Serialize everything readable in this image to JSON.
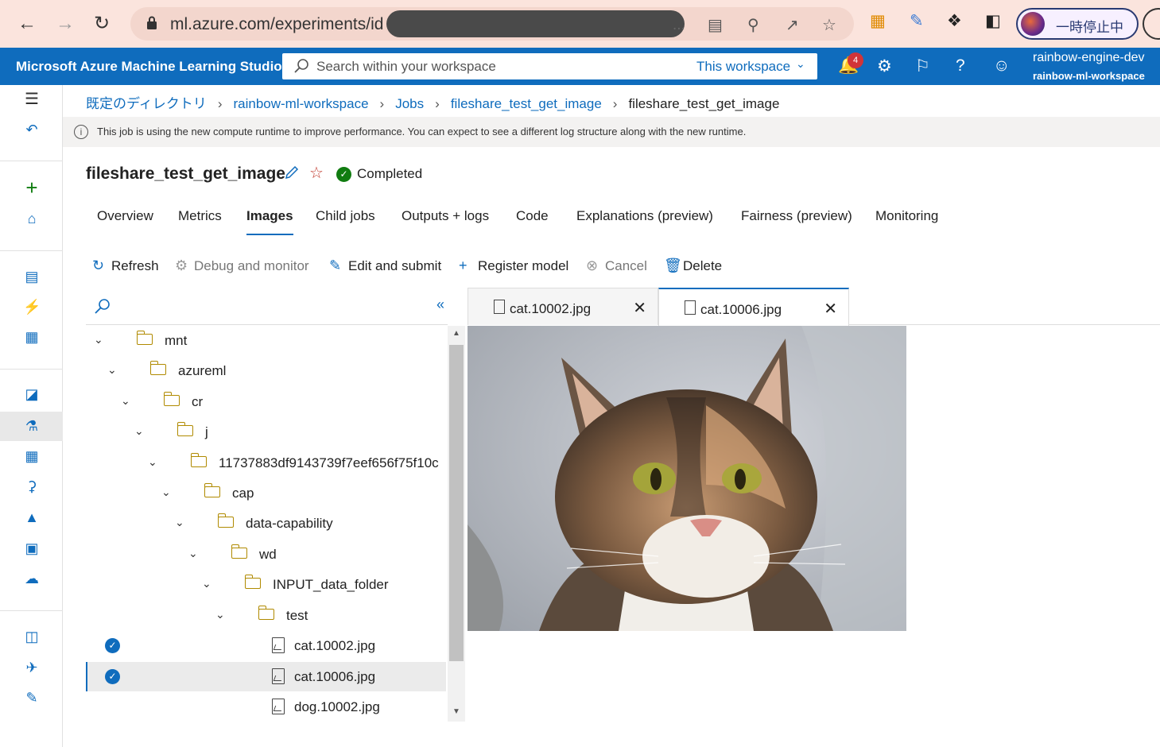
{
  "browser": {
    "url": "ml.azure.com/experiments/id",
    "url_tail": "...",
    "profile_label": "一時停止中"
  },
  "header": {
    "brand": "Microsoft Azure Machine Learning Studio",
    "search_placeholder": "Search within your workspace",
    "scope": "This workspace",
    "notifications": "4",
    "account_name": "rainbow-engine-dev",
    "workspace_name": "rainbow-ml-workspace"
  },
  "breadcrumb": {
    "items": [
      "既定のディレクトリ",
      "rainbow-ml-workspace",
      "Jobs",
      "fileshare_test_get_image"
    ],
    "current": "fileshare_test_get_image"
  },
  "info_banner": "This job is using the new compute runtime to improve performance. You can expect to see a different log structure along with the new runtime.",
  "job": {
    "title": "fileshare_test_get_image",
    "status": "Completed"
  },
  "tabs": [
    "Overview",
    "Metrics",
    "Images",
    "Child jobs",
    "Outputs + logs",
    "Code",
    "Explanations (preview)",
    "Fairness (preview)",
    "Monitoring"
  ],
  "toolbar": {
    "refresh": "Refresh",
    "debug": "Debug and monitor",
    "edit": "Edit and submit",
    "register": "Register model",
    "cancel": "Cancel",
    "delete": "Delete"
  },
  "tree": [
    {
      "label": "mnt",
      "type": "folder"
    },
    {
      "label": "azureml",
      "type": "folder"
    },
    {
      "label": "cr",
      "type": "folder"
    },
    {
      "label": "j",
      "type": "folder"
    },
    {
      "label": "11737883df9143739f7eef656f75f10c",
      "type": "folder"
    },
    {
      "label": "cap",
      "type": "folder"
    },
    {
      "label": "data-capability",
      "type": "folder"
    },
    {
      "label": "wd",
      "type": "folder"
    },
    {
      "label": "INPUT_data_folder",
      "type": "folder"
    },
    {
      "label": "test",
      "type": "folder"
    },
    {
      "label": "cat.10002.jpg",
      "type": "file",
      "checked": true
    },
    {
      "label": "cat.10006.jpg",
      "type": "file",
      "checked": true,
      "selected": true
    },
    {
      "label": "dog.10002.jpg",
      "type": "file",
      "checked": false
    }
  ],
  "preview_tabs": [
    "cat.10002.jpg",
    "cat.10006.jpg"
  ],
  "colors": {
    "accent": "#0f6cbd",
    "success": "#107c10",
    "badge": "#d13438"
  }
}
